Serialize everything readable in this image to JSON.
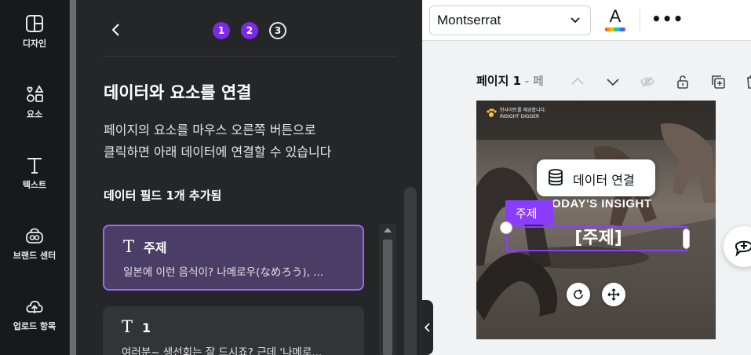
{
  "sidebar": {
    "items": [
      {
        "label": "디자인",
        "icon": "layout-icon"
      },
      {
        "label": "요소",
        "icon": "shapes-icon"
      },
      {
        "label": "텍스트",
        "icon": "text-icon"
      },
      {
        "label": "브랜드 센터",
        "icon": "brand-icon"
      },
      {
        "label": "업로드 항목",
        "icon": "cloud-upload-icon"
      }
    ]
  },
  "panel": {
    "steps": [
      "1",
      "2",
      "3"
    ],
    "title": "데이터와 요소를 연결",
    "description_line1": "페이지의 요소를 마우스 오른쪽 버튼으로",
    "description_line2": "클릭하면 아래 데이터에 연결할 수 있습니다",
    "fields_added": "데이터 필드 1개 추가됨",
    "fields": [
      {
        "name": "주제",
        "preview": "일본에 이런 음식이? 나메로우(なめろう), ..."
      },
      {
        "name": "1",
        "preview": "여러분~ 생선회는 잘 드시죠? 근데 '나메로..."
      }
    ]
  },
  "toolbar": {
    "font": "Montserrat",
    "text_color_letter": "A",
    "more": "•••"
  },
  "page_header": {
    "label": "페이지 1",
    "suffix": " - 페"
  },
  "canvas": {
    "brand_line1": "인사이트를 제공합니다.",
    "brand_line2": "INSIGHT DIGGER",
    "headline": "ODAY'S INSIGHT",
    "popup_label": "데이터 연결",
    "tag": "주제",
    "field_text": "[주제]"
  },
  "colors": {
    "accent": "#8b3dff",
    "step_active": "#7d2ae8",
    "panel_bg": "#252627",
    "rail_bg": "#18191b"
  }
}
